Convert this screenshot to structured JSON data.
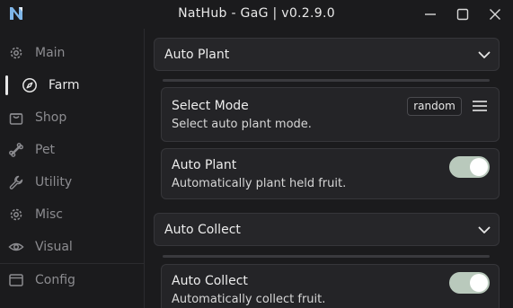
{
  "window": {
    "title": "NatHub - GaG | v0.2.9.0",
    "logo_icon": "n-logo-icon",
    "controls": [
      "minimize-icon",
      "maximize-icon",
      "close-icon"
    ]
  },
  "sidebar": {
    "items": [
      {
        "label": "Main",
        "icon": "gear-icon"
      },
      {
        "label": "Farm",
        "icon": "compass-icon",
        "active": true
      },
      {
        "label": "Shop",
        "icon": "shopping-bag-icon"
      },
      {
        "label": "Pet",
        "icon": "bone-icon"
      },
      {
        "label": "Utility",
        "icon": "wrench-icon"
      },
      {
        "label": "Misc",
        "icon": "gear-icon"
      },
      {
        "label": "Visual",
        "icon": "eye-icon"
      }
    ],
    "footer_item": {
      "label": "Config",
      "icon": "window-icon"
    }
  },
  "sections": [
    {
      "title": "Auto Plant",
      "cards": [
        {
          "title": "Select Mode",
          "desc": "Select auto plant mode.",
          "dropdown_value": "random"
        },
        {
          "title": "Auto Plant",
          "desc": "Automatically plant held fruit.",
          "toggle_on": true
        }
      ]
    },
    {
      "title": "Auto Collect",
      "cards": [
        {
          "title": "Auto Collect",
          "desc": "Automatically collect fruit.",
          "toggle_on": true
        }
      ]
    }
  ],
  "colors": {
    "background": "#1b1b1d",
    "card": "#242427",
    "toggle_on": "#b9c9bc",
    "muted_text": "#8c8c90"
  }
}
